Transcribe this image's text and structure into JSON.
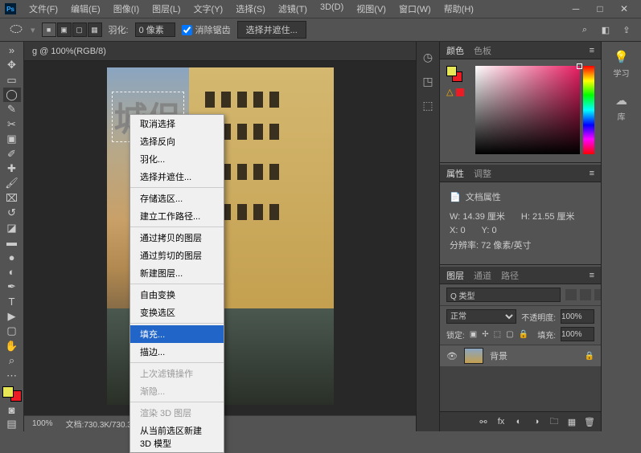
{
  "menubar": {
    "items": [
      "文件(F)",
      "编辑(E)",
      "图像(I)",
      "图层(L)",
      "文字(Y)",
      "选择(S)",
      "滤镜(T)",
      "3D(D)",
      "视图(V)",
      "窗口(W)",
      "帮助(H)"
    ]
  },
  "optionsbar": {
    "feather_label": "羽化:",
    "feather_value": "0 像素",
    "antialias": "消除锯齿",
    "select_subject": "选择并遮住..."
  },
  "doc_tab": "g @ 100%(RGB/8)",
  "canvas_text": "城侣",
  "context_menu": {
    "items": [
      {
        "label": "取消选择",
        "disabled": false
      },
      {
        "label": "选择反向",
        "disabled": false
      },
      {
        "label": "羽化...",
        "disabled": false
      },
      {
        "label": "选择并遮住...",
        "disabled": false
      },
      {
        "sep": true
      },
      {
        "label": "存储选区...",
        "disabled": false
      },
      {
        "label": "建立工作路径...",
        "disabled": false
      },
      {
        "sep": true
      },
      {
        "label": "通过拷贝的图层",
        "disabled": false
      },
      {
        "label": "通过剪切的图层",
        "disabled": false
      },
      {
        "label": "新建图层...",
        "disabled": false
      },
      {
        "sep": true
      },
      {
        "label": "自由变换",
        "disabled": false
      },
      {
        "label": "变换选区",
        "disabled": false
      },
      {
        "sep": true
      },
      {
        "label": "填充...",
        "disabled": false,
        "highlighted": true
      },
      {
        "label": "描边...",
        "disabled": false
      },
      {
        "sep": true
      },
      {
        "label": "上次滤镜操作",
        "disabled": true
      },
      {
        "label": "渐隐...",
        "disabled": true
      },
      {
        "sep": true
      },
      {
        "label": "渲染 3D 图层",
        "disabled": true
      },
      {
        "label": "从当前选区新建 3D 模型",
        "disabled": false
      }
    ]
  },
  "statusbar": {
    "zoom": "100%",
    "doc_size": "文档:730.3K/730.3K"
  },
  "panels": {
    "color_tabs": [
      "颜色",
      "色板"
    ],
    "warn": "△",
    "props_tabs": [
      "属性",
      "调整"
    ],
    "props_title": "文档属性",
    "props": {
      "w_label": "W:",
      "w_value": "14.39 厘米",
      "h_label": "H:",
      "h_value": "21.55 厘米",
      "x_label": "X:",
      "x_value": "0",
      "y_label": "Y:",
      "y_value": "0",
      "res": "分辨率: 72 像素/英寸"
    },
    "layers_tabs": [
      "图层",
      "通道",
      "路径"
    ],
    "layer_kind": "Q 类型",
    "blend_mode": "正常",
    "opacity_label": "不透明度:",
    "opacity_value": "100%",
    "lock_label": "锁定:",
    "fill_label": "填充:",
    "fill_value": "100%",
    "layer_background": "背景"
  },
  "rail": {
    "learn": "学习",
    "library": "库"
  }
}
